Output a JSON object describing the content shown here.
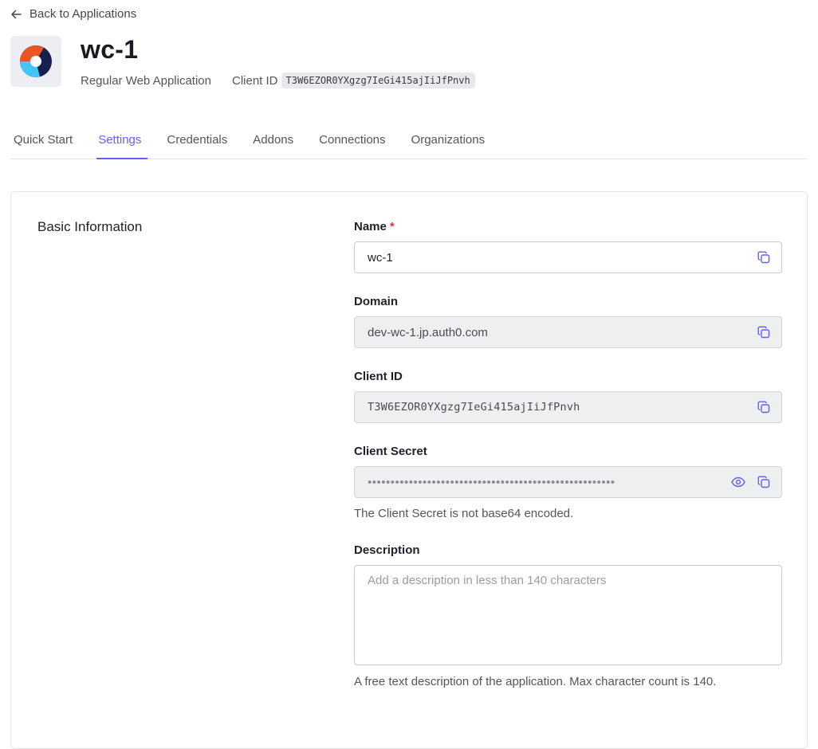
{
  "nav": {
    "back_label": "Back to Applications"
  },
  "app": {
    "name": "wc-1",
    "type": "Regular Web Application",
    "client_id_label": "Client ID",
    "client_id": "T3W6EZOR0YXgzg7IeGi415ajIiJfPnvh"
  },
  "tabs": [
    {
      "label": "Quick Start",
      "active": false
    },
    {
      "label": "Settings",
      "active": true
    },
    {
      "label": "Credentials",
      "active": false
    },
    {
      "label": "Addons",
      "active": false
    },
    {
      "label": "Connections",
      "active": false
    },
    {
      "label": "Organizations",
      "active": false
    }
  ],
  "section": {
    "title": "Basic Information"
  },
  "fields": {
    "name": {
      "label": "Name",
      "required_mark": "*",
      "value": "wc-1"
    },
    "domain": {
      "label": "Domain",
      "value": "dev-wc-1.jp.auth0.com"
    },
    "client_id": {
      "label": "Client ID",
      "value": "T3W6EZOR0YXgzg7IeGi415ajIiJfPnvh"
    },
    "client_secret": {
      "label": "Client Secret",
      "masked_value": "••••••••••••••••••••••••••••••••••••••••••••••••••••••",
      "helper": "The Client Secret is not base64 encoded."
    },
    "description": {
      "label": "Description",
      "placeholder": "Add a description in less than 140 characters",
      "helper": "A free text description of the application. Max character count is 140."
    }
  },
  "colors": {
    "accent": "#635dff",
    "required": "#d03c38",
    "logo_orange": "#eb5424",
    "logo_navy": "#16214d",
    "logo_blue": "#44c7f4"
  },
  "icons": {
    "back": "arrow-left-icon",
    "copy": "copy-icon",
    "reveal": "eye-icon",
    "logo": "app-logo-icon"
  }
}
